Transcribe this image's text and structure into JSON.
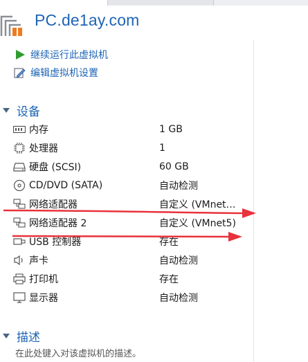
{
  "header": {
    "title": "PC.de1ay.com"
  },
  "actions": [
    {
      "label": "继续运行此虚拟机",
      "icon": "play-icon"
    },
    {
      "label": "编辑虚拟机设置",
      "icon": "edit-settings-icon"
    }
  ],
  "devices": {
    "title": "设备",
    "items": [
      {
        "name": "内存",
        "value": "1 GB",
        "icon": "memory-icon"
      },
      {
        "name": "处理器",
        "value": "1",
        "icon": "cpu-icon"
      },
      {
        "name": "硬盘 (SCSI)",
        "value": "60 GB",
        "icon": "hard-disk-icon"
      },
      {
        "name": "CD/DVD (SATA)",
        "value": "自动检测",
        "icon": "cd-dvd-icon"
      },
      {
        "name": "网络适配器",
        "value": "自定义 (VMnet…",
        "icon": "network-adapter-icon"
      },
      {
        "name": "网络适配器 2",
        "value": "自定义 (VMnet5)",
        "icon": "network-adapter-icon"
      },
      {
        "name": "USB 控制器",
        "value": "存在",
        "icon": "usb-icon"
      },
      {
        "name": "声卡",
        "value": "自动检测",
        "icon": "sound-icon"
      },
      {
        "name": "打印机",
        "value": "存在",
        "icon": "printer-icon"
      },
      {
        "name": "显示器",
        "value": "自动检测",
        "icon": "monitor-icon"
      }
    ]
  },
  "description": {
    "title": "描述",
    "placeholder": "在此处键入对该虚拟机的描述。"
  },
  "colors": {
    "accent": "#1d64b5",
    "annotation_arrow": "#e8323c",
    "play": "#2f9e2f"
  }
}
